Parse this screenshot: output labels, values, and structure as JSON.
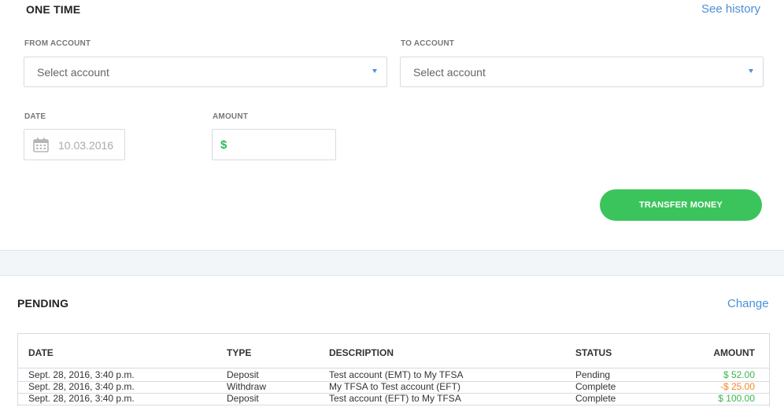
{
  "one_time": {
    "title": "ONE TIME",
    "see_history": "See history",
    "from_label": "FROM ACCOUNT",
    "from_value": "Select account",
    "to_label": "TO ACCOUNT",
    "to_value": "Select account",
    "date_label": "DATE",
    "date_value": "10.03.2016",
    "amount_label": "AMOUNT",
    "amount_prefix": "$",
    "amount_value": "",
    "transfer_button": "TRANSFER MONEY"
  },
  "pending": {
    "title": "PENDING",
    "change": "Change",
    "columns": [
      "DATE",
      "TYPE",
      "DESCRIPTION",
      "STATUS",
      "AMOUNT"
    ],
    "rows": [
      {
        "date": "Sept. 28, 2016, 3:40 p.m.",
        "type": "Deposit",
        "description": "Test account (EMT) to My TFSA",
        "status": "Pending",
        "amount": "$ 52.00",
        "amount_color": "#3bb54a"
      },
      {
        "date": "Sept. 28, 2016, 3:40 p.m.",
        "type": "Withdraw",
        "description": "My TFSA to Test account (EFT)",
        "status": "Complete",
        "amount": "-$ 25.00",
        "amount_color": "#f08a24"
      },
      {
        "date": "Sept. 28, 2016, 3:40 p.m.",
        "type": "Deposit",
        "description": "Test account (EFT) to My TFSA",
        "status": "Complete",
        "amount": "$ 100.00",
        "amount_color": "#3bb54a"
      }
    ]
  },
  "colors": {
    "accent_link": "#4a90d9",
    "button_green": "#3cc45c",
    "positive": "#3bb54a",
    "negative": "#f08a24"
  },
  "icons": {
    "calendar": "calendar-icon",
    "dropdown": "chevron-down-icon"
  }
}
